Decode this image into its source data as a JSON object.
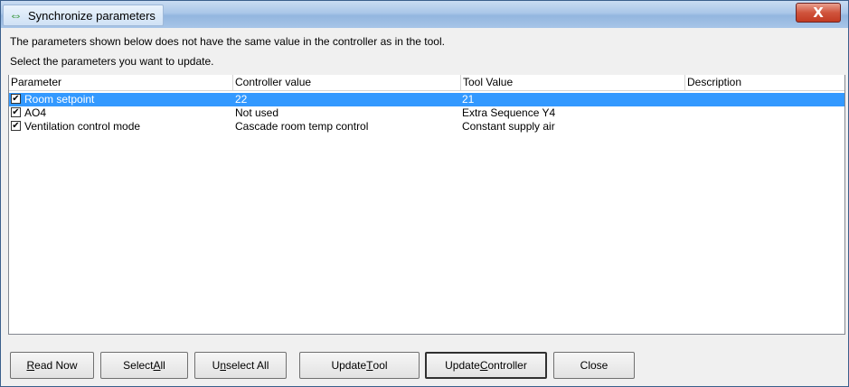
{
  "window": {
    "title": "Synchronize parameters",
    "close_glyph": "X"
  },
  "info": {
    "line1": "The parameters shown below does not have the same value in the controller as in the tool.",
    "line2": "Select the parameters you want to update."
  },
  "table": {
    "columns": [
      "Parameter",
      "Controller value",
      "Tool Value",
      "Description"
    ],
    "rows": [
      {
        "checked": true,
        "parameter": "Room setpoint",
        "controller_value": "22",
        "tool_value": "21",
        "description": ""
      },
      {
        "checked": true,
        "parameter": "AO4",
        "controller_value": "Not used",
        "tool_value": "Extra Sequence Y4",
        "description": ""
      },
      {
        "checked": true,
        "parameter": "Ventilation control mode",
        "controller_value": "Cascade room temp control",
        "tool_value": "Constant supply air",
        "description": ""
      }
    ]
  },
  "buttons": {
    "read_now": {
      "pre": "",
      "mnemonic": "R",
      "post": "ead Now"
    },
    "select_all": {
      "pre": "Select ",
      "mnemonic": "A",
      "post": "ll"
    },
    "unselect_all": {
      "pre": "U",
      "mnemonic": "n",
      "post": "select All"
    },
    "update_tool": {
      "pre": "Update ",
      "mnemonic": "T",
      "post": "ool"
    },
    "update_controller": {
      "pre": "Update ",
      "mnemonic": "C",
      "post": "ontroller"
    },
    "close": {
      "pre": "Close",
      "mnemonic": "",
      "post": ""
    }
  },
  "icons": {
    "title_icon": "sync-arrows-icon",
    "checkbox_glyph": "✔"
  },
  "colors": {
    "selection": "#3399ff",
    "title_icon": "#1e8a1e",
    "close_button": "#c23a22"
  }
}
